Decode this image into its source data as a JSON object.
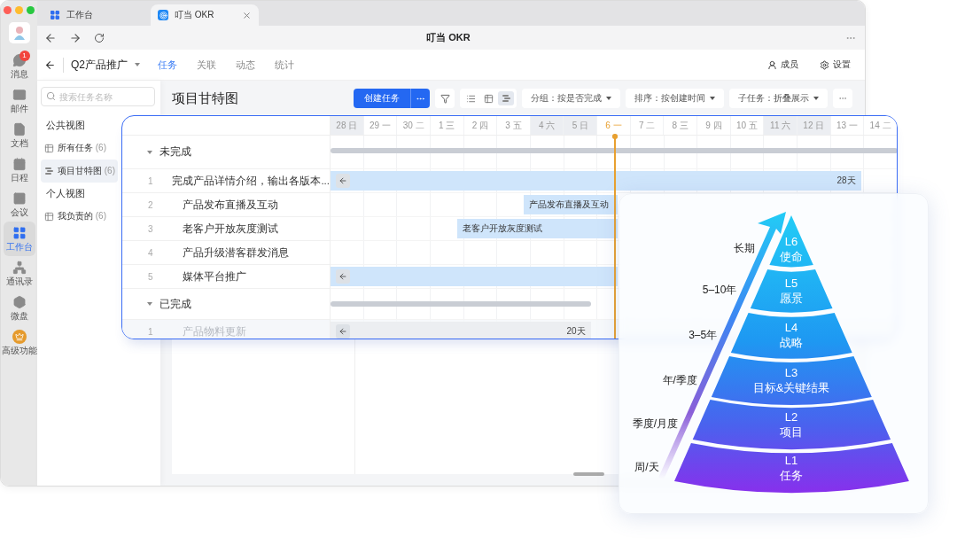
{
  "window": {
    "tabs": [
      {
        "label": "工作台",
        "kind": "workbench",
        "selected": false
      },
      {
        "label": "叮当 OKR",
        "kind": "okr",
        "selected": true
      }
    ],
    "title": "叮当 OKR"
  },
  "rail": {
    "items": [
      {
        "label": "消息",
        "kind": "chat",
        "badge": "1",
        "selected": false
      },
      {
        "label": "邮件",
        "kind": "mail",
        "selected": false
      },
      {
        "label": "文档",
        "kind": "doc",
        "selected": false
      },
      {
        "label": "日程",
        "kind": "calendar",
        "selected": false
      },
      {
        "label": "会议",
        "kind": "meeting",
        "selected": false
      },
      {
        "label": "工作台",
        "kind": "workbench",
        "selected": true
      },
      {
        "label": "通讯录",
        "kind": "contacts",
        "selected": false
      },
      {
        "label": "微盘",
        "kind": "drive",
        "selected": false
      },
      {
        "label": "高级功能",
        "kind": "premium",
        "selected": false
      }
    ]
  },
  "project": {
    "name": "Q2产品推广",
    "tabs": [
      {
        "label": "任务",
        "selected": true
      },
      {
        "label": "关联",
        "selected": false
      },
      {
        "label": "动态",
        "selected": false
      },
      {
        "label": "统计",
        "selected": false
      }
    ],
    "actions": [
      {
        "label": "成员",
        "kind": "members"
      },
      {
        "label": "设置",
        "kind": "settings"
      }
    ]
  },
  "sidebar": {
    "search": {
      "placeholder": "搜索任务名称"
    },
    "sections": [
      {
        "title": "公共视图",
        "items": [
          {
            "label": "所有任务",
            "count": "(6)",
            "kind": "table",
            "selected": false
          },
          {
            "label": "项目甘特图",
            "count": "(6)",
            "kind": "gantt",
            "selected": true
          }
        ]
      },
      {
        "title": "个人视图",
        "items": [
          {
            "label": "我负责的",
            "count": "(6)",
            "kind": "table",
            "selected": false
          }
        ]
      }
    ]
  },
  "toolbar": {
    "title": "项目甘特图",
    "create_button": "创建任务",
    "views": [
      {
        "kind": "list",
        "selected": false
      },
      {
        "kind": "table",
        "selected": false
      },
      {
        "kind": "gantt",
        "selected": true
      }
    ],
    "dropdowns": [
      "分组：按是否完成",
      "排序：按创建时间",
      "子任务：折叠展示"
    ]
  },
  "gantt": {
    "days": [
      {
        "label": "28 日",
        "weekend": true,
        "today": false
      },
      {
        "label": "29 一",
        "weekend": false,
        "today": false
      },
      {
        "label": "30 二",
        "weekend": false,
        "today": false
      },
      {
        "label": "1 三",
        "weekend": false,
        "today": false
      },
      {
        "label": "2 四",
        "weekend": false,
        "today": false
      },
      {
        "label": "3 五",
        "weekend": false,
        "today": false
      },
      {
        "label": "4 六",
        "weekend": true,
        "today": false
      },
      {
        "label": "5 日",
        "weekend": true,
        "today": false
      },
      {
        "label": "6 一",
        "weekend": false,
        "today": true
      },
      {
        "label": "7 二",
        "weekend": false,
        "today": false
      },
      {
        "label": "8 三",
        "weekend": false,
        "today": false
      },
      {
        "label": "9 四",
        "weekend": false,
        "today": false
      },
      {
        "label": "10 五",
        "weekend": false,
        "today": false
      },
      {
        "label": "11 六",
        "weekend": true,
        "today": false
      },
      {
        "label": "12 日",
        "weekend": true,
        "today": false
      },
      {
        "label": "13 一",
        "weekend": false,
        "today": false
      },
      {
        "label": "14 二",
        "weekend": false,
        "today": false
      }
    ],
    "groups": [
      {
        "label": "未完成",
        "expanded": true,
        "bar": {
          "kind": "summary"
        },
        "tasks": [
          {
            "index": "1",
            "name": "完成产品详情介绍，输出各版本...",
            "done": false,
            "bar": {
              "kind": "task",
              "back_arrow": true,
              "duration": "28天"
            }
          },
          {
            "index": "2",
            "name": "产品发布直播及互动",
            "done": false,
            "bar": {
              "kind": "task",
              "back_arrow": false,
              "text": "产品发布直播及互动"
            }
          },
          {
            "index": "3",
            "name": "老客户开放灰度测试",
            "done": false,
            "bar": {
              "kind": "task",
              "back_arrow": false,
              "text": "老客户开放灰度测试"
            }
          },
          {
            "index": "4",
            "name": "产品升级潜客群发消息",
            "done": false
          },
          {
            "index": "5",
            "name": "媒体平台推广",
            "done": false,
            "bar": {
              "kind": "task",
              "back_arrow": true
            }
          }
        ]
      },
      {
        "label": "已完成",
        "expanded": true,
        "bar": {
          "kind": "summary"
        },
        "tasks": [
          {
            "index": "1",
            "name": "产品物料更新",
            "done": true,
            "bar": {
              "kind": "done",
              "back_arrow": true,
              "duration": "20天"
            }
          }
        ]
      }
    ]
  },
  "pyramid": {
    "levels": [
      {
        "code": "L6",
        "name": "使命",
        "horizon": "长期"
      },
      {
        "code": "L5",
        "name": "愿景",
        "horizon": "5–10年"
      },
      {
        "code": "L4",
        "name": "战略",
        "horizon": "3–5年"
      },
      {
        "code": "L3",
        "name": "目标&关键结果",
        "horizon": "年/季度"
      },
      {
        "code": "L2",
        "name": "项目",
        "horizon": "季度/月度"
      },
      {
        "code": "L1",
        "name": "任务",
        "horizon": "周/天"
      }
    ]
  }
}
